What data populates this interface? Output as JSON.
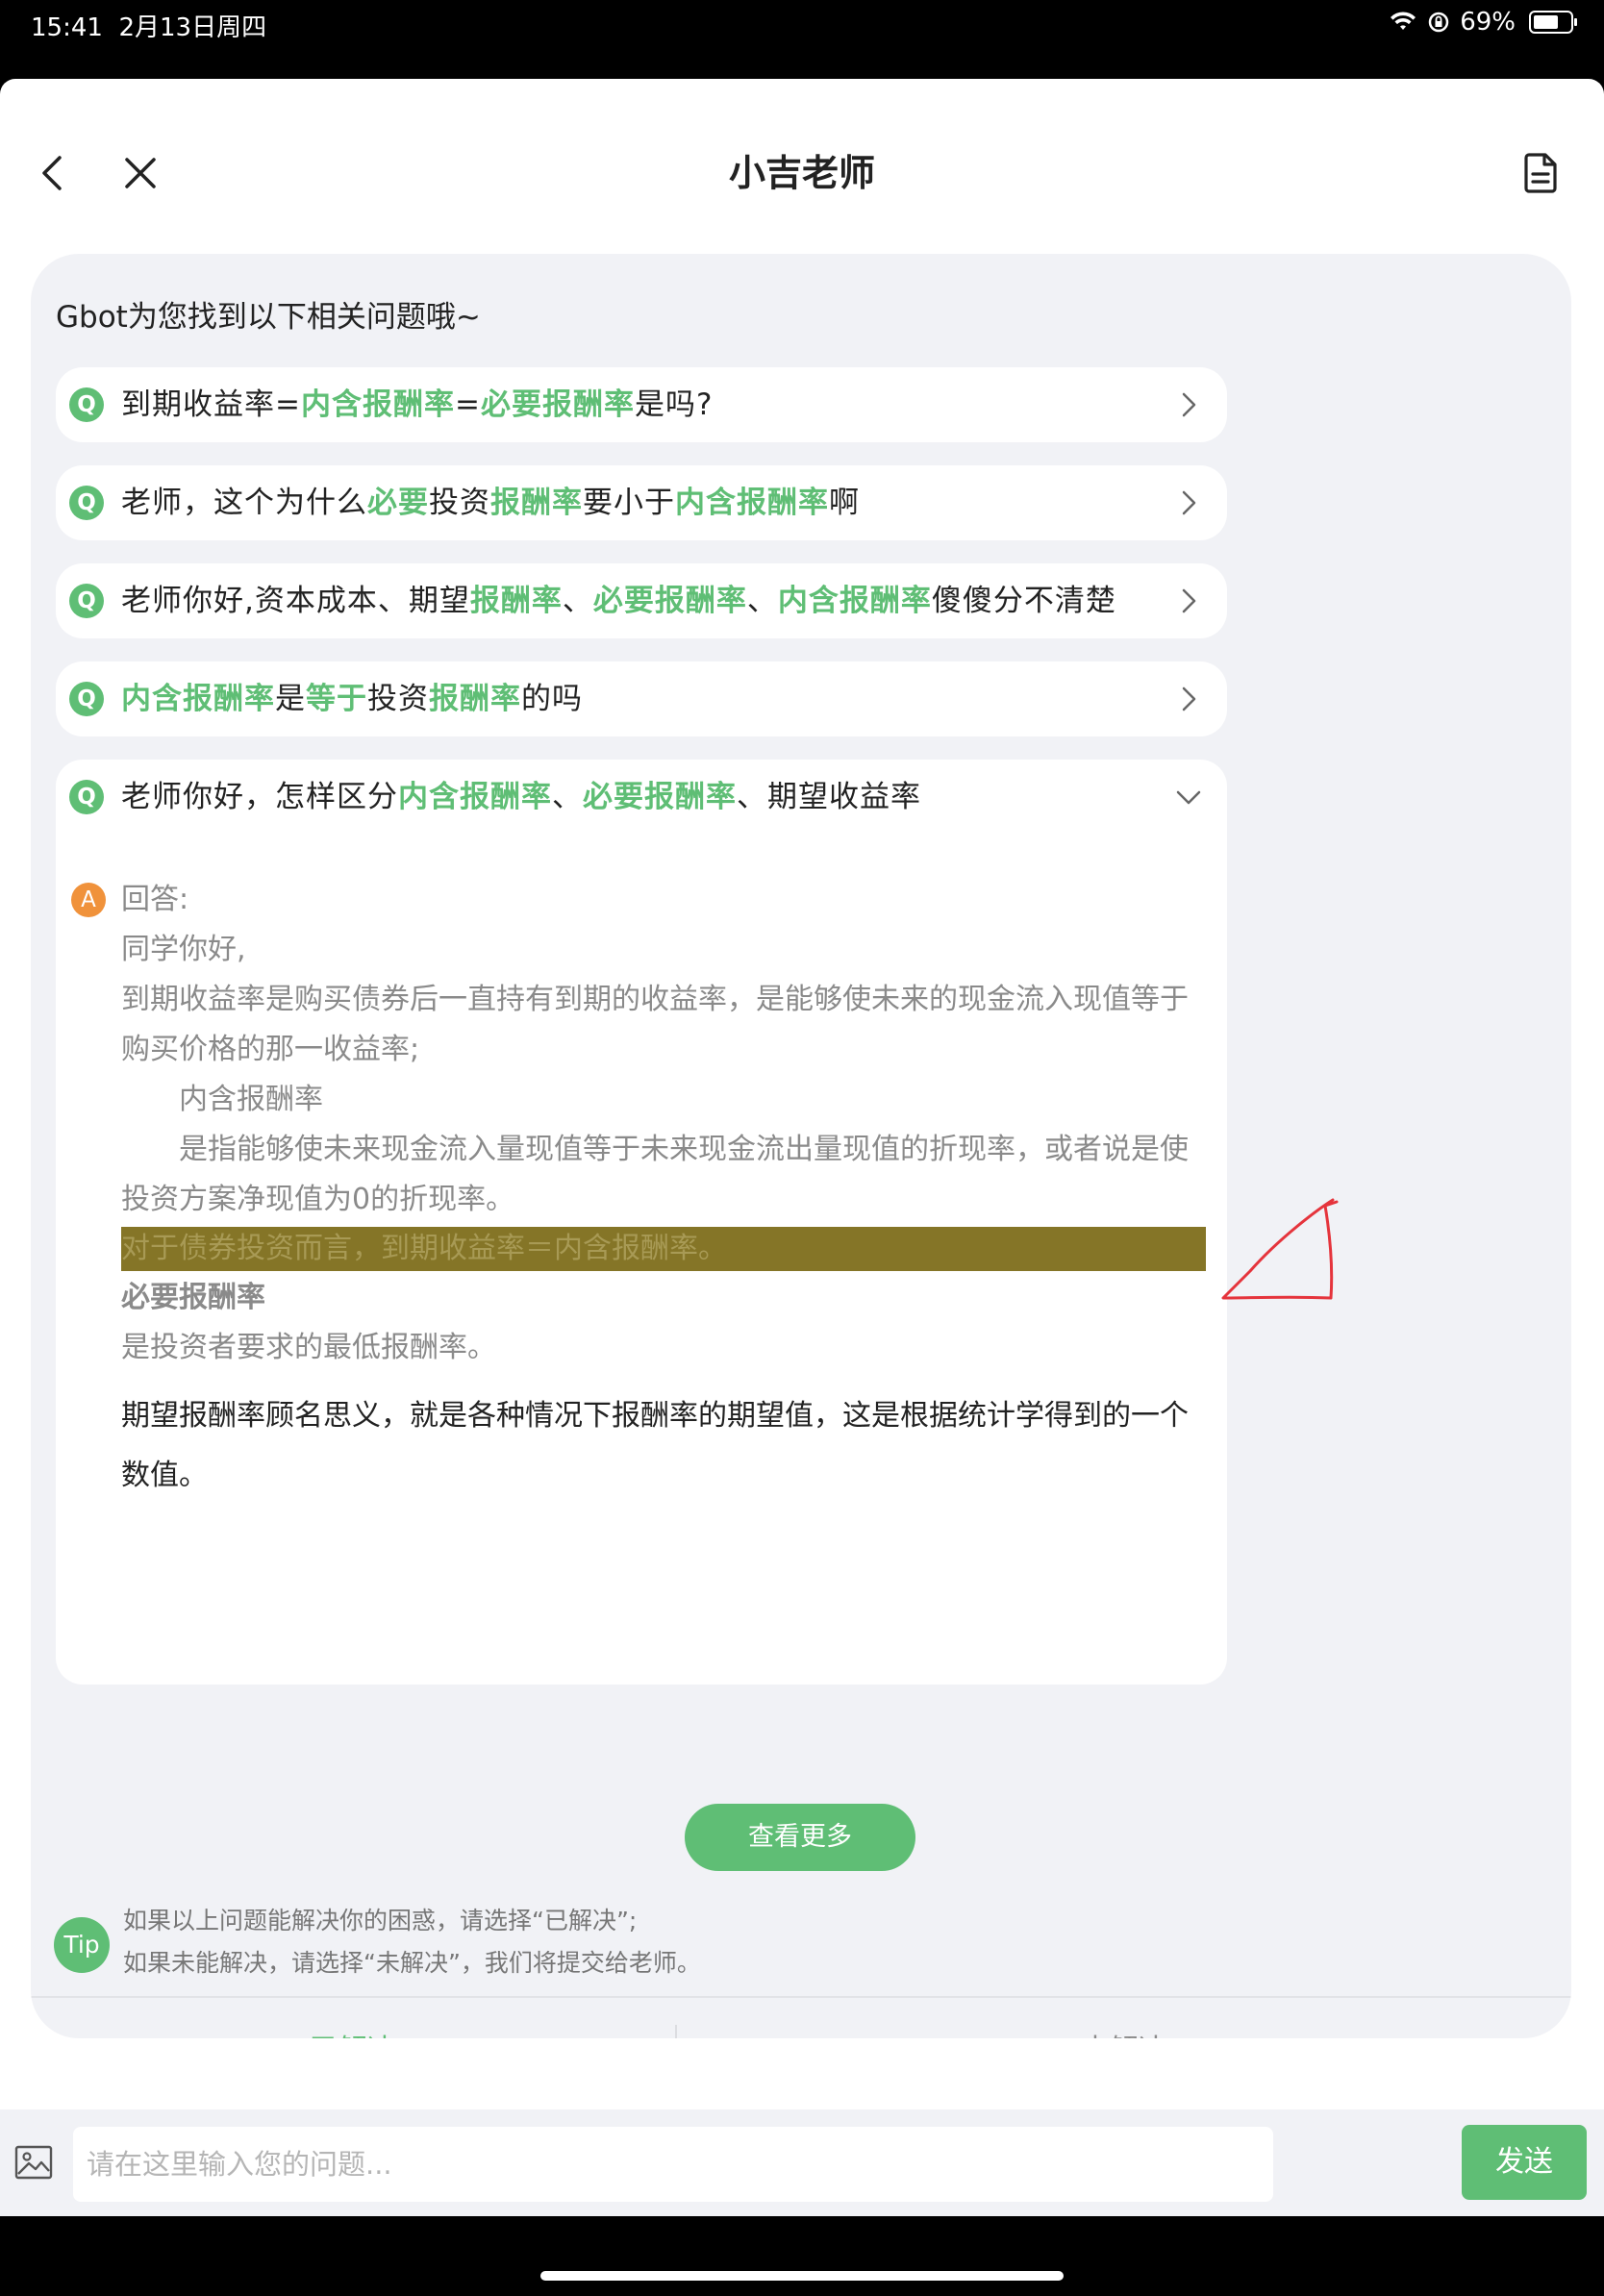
{
  "status": {
    "time": "15:41",
    "date": "2月13日周四",
    "battery": "69%",
    "battery_level": 0.69
  },
  "nav": {
    "title": "小吉老师"
  },
  "intro": "Gbot为您找到以下相关问题哦~",
  "questions": [
    {
      "segments": [
        {
          "t": "到期收益率=",
          "h": false
        },
        {
          "t": "内含报酬率",
          "h": true
        },
        {
          "t": "=",
          "h": false
        },
        {
          "t": "必要报酬率",
          "h": true
        },
        {
          "t": "是吗?",
          "h": false
        }
      ]
    },
    {
      "segments": [
        {
          "t": "老师，这个为什么",
          "h": false
        },
        {
          "t": "必要",
          "h": true
        },
        {
          "t": "投资",
          "h": false
        },
        {
          "t": "报酬率",
          "h": true
        },
        {
          "t": "要小于",
          "h": false
        },
        {
          "t": "内含报酬率",
          "h": true
        },
        {
          "t": "啊",
          "h": false
        }
      ]
    },
    {
      "segments": [
        {
          "t": "老师你好,资本成本、期望",
          "h": false
        },
        {
          "t": "报酬率",
          "h": true
        },
        {
          "t": "、",
          "h": false
        },
        {
          "t": "必要报酬率",
          "h": true
        },
        {
          "t": "、",
          "h": false
        },
        {
          "t": "内含报酬率",
          "h": true
        },
        {
          "t": "傻傻分不清楚",
          "h": false
        }
      ]
    },
    {
      "segments": [
        {
          "t": "内含报酬率",
          "h": true
        },
        {
          "t": "是",
          "h": false
        },
        {
          "t": "等于",
          "h": true
        },
        {
          "t": "投资",
          "h": false
        },
        {
          "t": "报酬率",
          "h": true
        },
        {
          "t": "的吗",
          "h": false
        }
      ]
    },
    {
      "segments": [
        {
          "t": "老师你好，怎样区分",
          "h": false
        },
        {
          "t": "内含报酬率",
          "h": true
        },
        {
          "t": "、",
          "h": false
        },
        {
          "t": "必要报酬率",
          "h": true
        },
        {
          "t": "、期望收益率",
          "h": false
        }
      ]
    }
  ],
  "answer": {
    "icon_letter": "A",
    "label": "回答:",
    "greeting": "同学你好,",
    "p1_line1": "到期收益率是购买债券后一直持有到期的收益率，是能够使未来的现金流入现值等于",
    "p1_line2": "购买价格的那一收益率;",
    "p2_title": "内含报酬率",
    "p2_line1": "是指能够使未来现金流入量现值等于未来现金流出量现值的折现率，或者说是使",
    "p2_line2": "投资方案净现值为0的折现率。",
    "highlight": "对于债券投资而言，到期收益率＝内含报酬率。",
    "p3_title": "必要报酬率",
    "p3_line": "是投资者要求的最低报酬率。",
    "p4_line1": "期望报酬率顾名思义，就是各种情况下报酬率的期望值，这是根据统计学得到的一个",
    "p4_line2": "数值。"
  },
  "more_button": "查看更多",
  "tip": {
    "badge": "Tip",
    "line1": "如果以上问题能解决你的困惑，请选择“已解决”;",
    "line2": "如果未能解决，请选择“未解决”，我们将提交给老师。"
  },
  "resolve": {
    "yes": "已解决",
    "no": "未解决"
  },
  "input": {
    "placeholder": "请在这里输入您的问题...",
    "value": ""
  },
  "send_button": "发送",
  "colors": {
    "accent": "#5fbe75",
    "answer_icon": "#f0923b",
    "highlight_bar": "#857527"
  }
}
